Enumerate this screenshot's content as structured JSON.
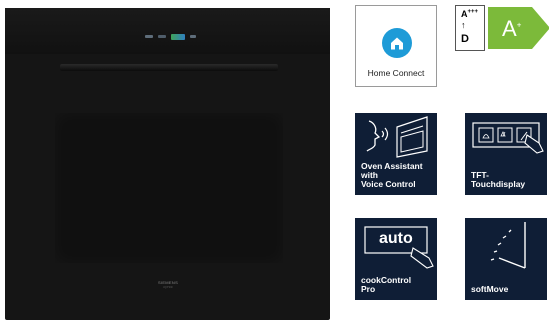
{
  "oven": {
    "brand": "SIEMENS",
    "brand_sub": "iQ700"
  },
  "energy_label": {
    "scale_top": "A",
    "scale_top_sup": "+++",
    "arrow": "↑",
    "scale_bottom": "D",
    "class": "A",
    "class_sup": "+",
    "color": "#7cba3a"
  },
  "tiles": [
    {
      "name": "home-connect",
      "label": "Home Connect",
      "style": "white",
      "icon": "home-connect-icon"
    },
    {
      "name": "oven-assistant",
      "label": "Oven Assistant\nwith\nVoice Control",
      "style": "dark",
      "icon": "voice-control-icon"
    },
    {
      "name": "tft-touchdisplay",
      "label": "TFT-\nTouchdisplay",
      "style": "dark",
      "icon": "touch-display-icon"
    },
    {
      "name": "cookcontrol-pro",
      "label": "cookControl\nPro",
      "style": "dark",
      "icon": "auto-button-icon",
      "button_text": "auto"
    },
    {
      "name": "softmove",
      "label": "softMove",
      "style": "dark",
      "icon": "soft-move-door-icon"
    }
  ],
  "colors": {
    "tile_dark": "#0f1e36",
    "home_connect_blue": "#1e9bd7",
    "oven_body": "#151515"
  }
}
